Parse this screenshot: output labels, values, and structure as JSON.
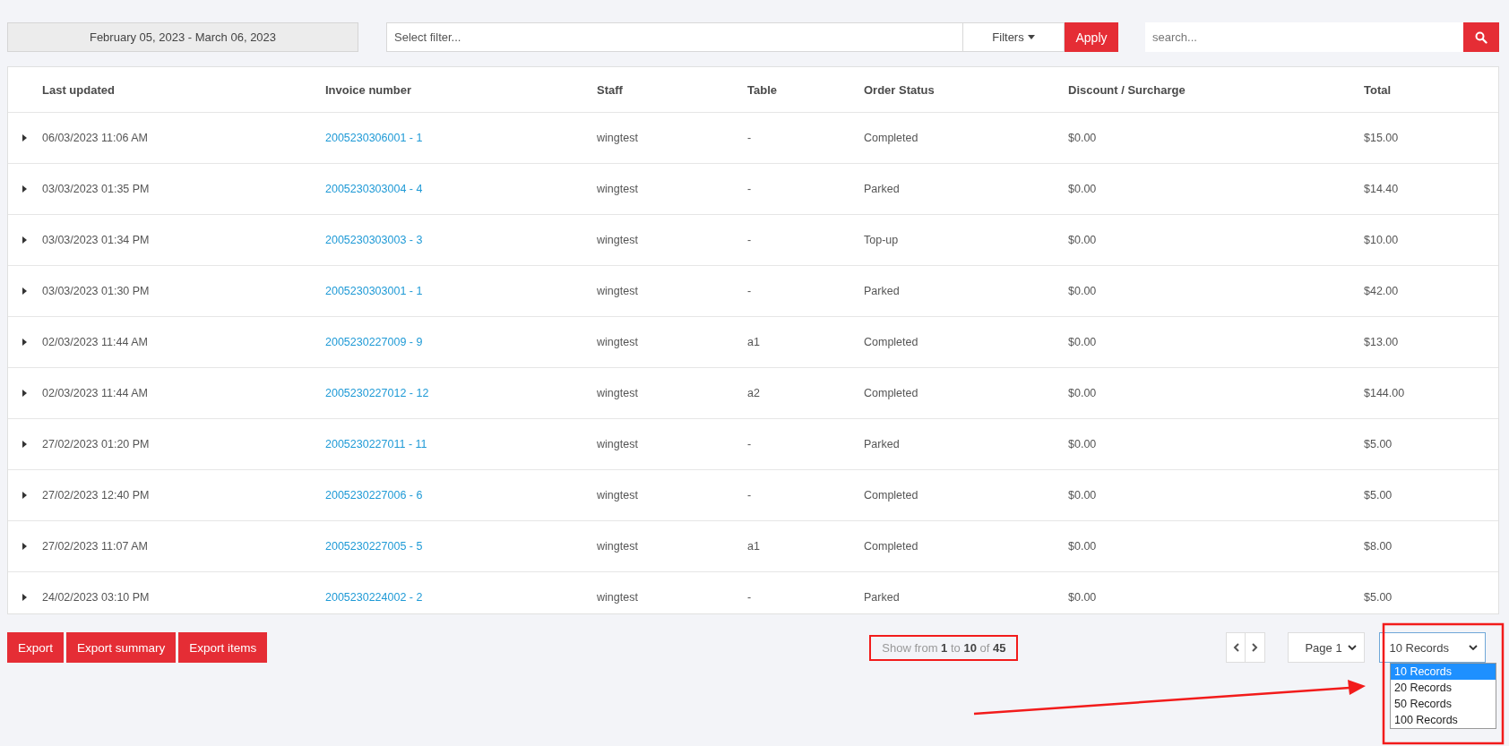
{
  "toolbar": {
    "date_range": "February 05, 2023 - March 06, 2023",
    "filter_placeholder": "Select filter...",
    "filters_button": "Filters",
    "apply_button": "Apply",
    "search_placeholder": "search..."
  },
  "table": {
    "columns": [
      "Last updated",
      "Invoice number",
      "Staff",
      "Table",
      "Order Status",
      "Discount / Surcharge",
      "Total"
    ],
    "rows": [
      {
        "expanded": false,
        "last_updated": "06/03/2023 11:06 AM",
        "invoice": "2005230306001 - 1",
        "staff": "wingtest",
        "table": "-",
        "status": "Completed",
        "discount": "$0.00",
        "total": "$15.00"
      },
      {
        "expanded": false,
        "last_updated": "03/03/2023 01:35 PM",
        "invoice": "2005230303004 - 4",
        "staff": "wingtest",
        "table": "-",
        "status": "Parked",
        "discount": "$0.00",
        "total": "$14.40"
      },
      {
        "expanded": false,
        "last_updated": "03/03/2023 01:34 PM",
        "invoice": "2005230303003 - 3",
        "staff": "wingtest",
        "table": "-",
        "status": "Top-up",
        "discount": "$0.00",
        "total": "$10.00"
      },
      {
        "expanded": false,
        "last_updated": "03/03/2023 01:30 PM",
        "invoice": "2005230303001 - 1",
        "staff": "wingtest",
        "table": "-",
        "status": "Parked",
        "discount": "$0.00",
        "total": "$42.00"
      },
      {
        "expanded": false,
        "last_updated": "02/03/2023 11:44 AM",
        "invoice": "2005230227009 - 9",
        "staff": "wingtest",
        "table": "a1",
        "status": "Completed",
        "discount": "$0.00",
        "total": "$13.00"
      },
      {
        "expanded": false,
        "last_updated": "02/03/2023 11:44 AM",
        "invoice": "2005230227012 - 12",
        "staff": "wingtest",
        "table": "a2",
        "status": "Completed",
        "discount": "$0.00",
        "total": "$144.00"
      },
      {
        "expanded": false,
        "last_updated": "27/02/2023 01:20 PM",
        "invoice": "2005230227011 - 11",
        "staff": "wingtest",
        "table": "-",
        "status": "Parked",
        "discount": "$0.00",
        "total": "$5.00"
      },
      {
        "expanded": false,
        "last_updated": "27/02/2023 12:40 PM",
        "invoice": "2005230227006 - 6",
        "staff": "wingtest",
        "table": "-",
        "status": "Completed",
        "discount": "$0.00",
        "total": "$5.00"
      },
      {
        "expanded": false,
        "last_updated": "27/02/2023 11:07 AM",
        "invoice": "2005230227005 - 5",
        "staff": "wingtest",
        "table": "a1",
        "status": "Completed",
        "discount": "$0.00",
        "total": "$8.00"
      },
      {
        "expanded": false,
        "last_updated": "24/02/2023 03:10 PM",
        "invoice": "2005230224002 - 2",
        "staff": "wingtest",
        "table": "-",
        "status": "Parked",
        "discount": "$0.00",
        "total": "$5.00"
      }
    ]
  },
  "footer": {
    "export_buttons": [
      "Export",
      "Export summary",
      "Export items"
    ],
    "summary": "Show from **1** to **10** of **45**",
    "page_select": "Page 1",
    "records_select": "10 Records",
    "records_options": [
      {
        "label": "10 Records",
        "selected": true
      },
      {
        "label": "20 Records",
        "selected": false
      },
      {
        "label": "50 Records",
        "selected": false
      },
      {
        "label": "100 Records",
        "selected": false
      }
    ]
  }
}
